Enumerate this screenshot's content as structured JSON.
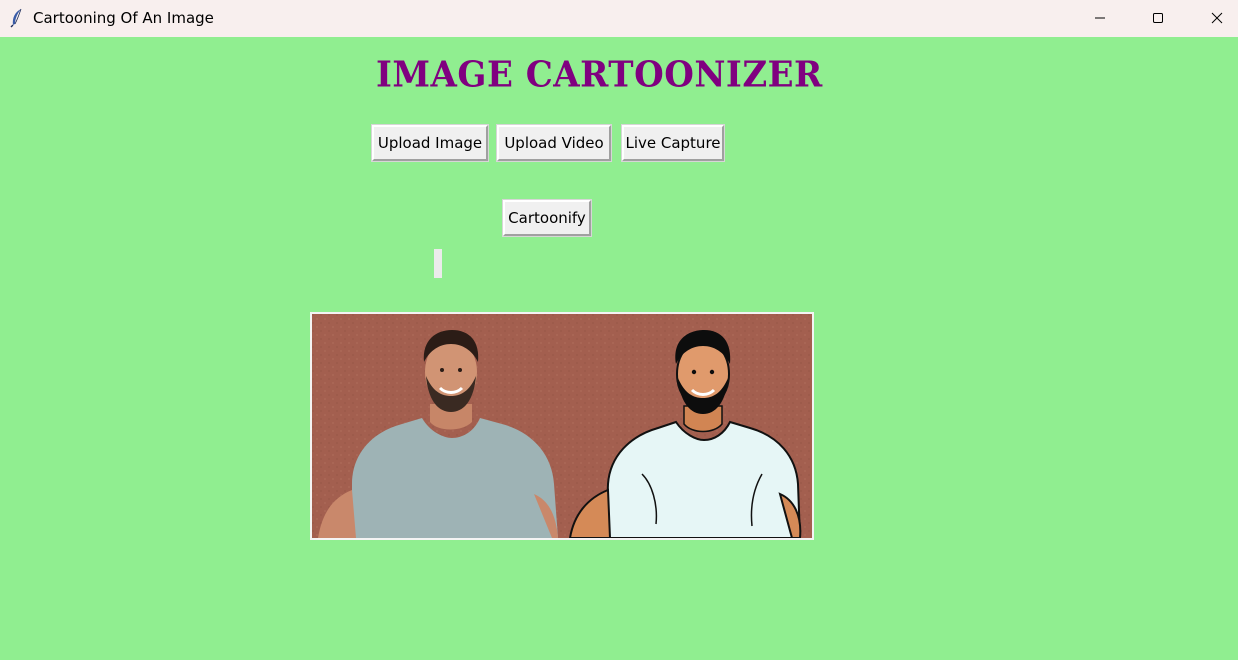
{
  "window": {
    "title": "Cartooning Of An Image",
    "icon": "feather-icon",
    "controls": [
      "minimize-icon",
      "maximize-icon",
      "close-icon"
    ]
  },
  "app": {
    "heading": "IMAGE CARTOONIZER",
    "heading_color": "#800080",
    "background_color": "#90ee90",
    "buttons": {
      "upload_image": "Upload Image",
      "upload_video": "Upload Video",
      "live_capture": "Live Capture",
      "cartoonify": "Cartoonify"
    },
    "status_label": "",
    "preview": {
      "left": "original photo of smiling man in gray t-shirt",
      "right": "cartoonized version of the same man in white t-shirt",
      "background_color": "#a35f4f"
    }
  }
}
